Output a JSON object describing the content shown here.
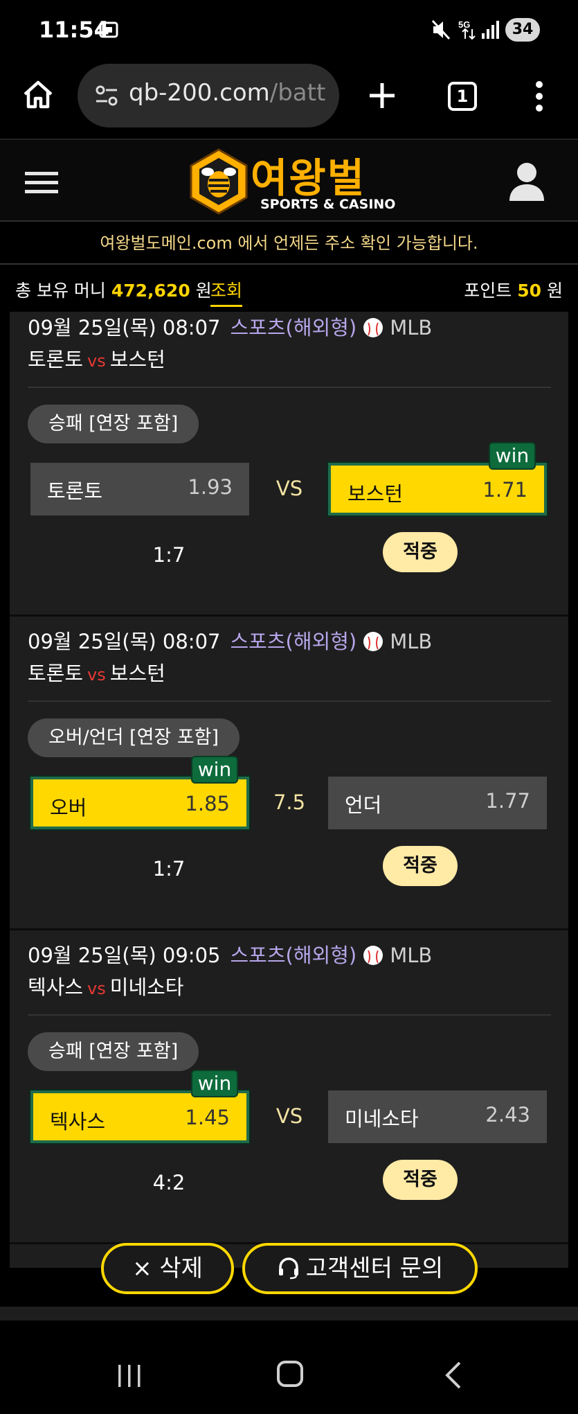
{
  "status_bar": {
    "time": "11:54",
    "battery": "34"
  },
  "browser": {
    "url_host": "qb-200.com",
    "url_path": "/batt",
    "tab_count": "1"
  },
  "site": {
    "logo_text": "여왕벌",
    "logo_sub": "SPORTS & CASINO",
    "notice": "여왕벌도메인.com 에서 언제든 주소 확인 가능합니다."
  },
  "balance": {
    "label": "총 보유 머니",
    "amount": "472,620",
    "unit": "원",
    "check": "조회",
    "points_label": "포인트",
    "points": "50",
    "points_unit": "원"
  },
  "bets": [
    {
      "datetime": "09월 25일(목) 08:07",
      "type": "스포츠(해외형)",
      "league": "MLB",
      "home": "토론토",
      "away": "보스턴",
      "vs": "vs",
      "market": "승패 [연장 포함]",
      "left": {
        "label": "토론토",
        "odds": "1.93",
        "win": false
      },
      "middle": "VS",
      "right": {
        "label": "보스턴",
        "odds": "1.71",
        "win": true
      },
      "win_tag": "win",
      "score": "1:7",
      "result": "적중"
    },
    {
      "datetime": "09월 25일(목) 08:07",
      "type": "스포츠(해외형)",
      "league": "MLB",
      "home": "토론토",
      "away": "보스턴",
      "vs": "vs",
      "market": "오버/언더 [연장 포함]",
      "left": {
        "label": "오버",
        "odds": "1.85",
        "win": true
      },
      "middle": "7.5",
      "right": {
        "label": "언더",
        "odds": "1.77",
        "win": false
      },
      "win_tag": "win",
      "score": "1:7",
      "result": "적중"
    },
    {
      "datetime": "09월 25일(목) 09:05",
      "type": "스포츠(해외형)",
      "league": "MLB",
      "home": "텍사스",
      "away": "미네소타",
      "vs": "vs",
      "market": "승패 [연장 포함]",
      "left": {
        "label": "텍사스",
        "odds": "1.45",
        "win": true
      },
      "middle": "VS",
      "right": {
        "label": "미네소타",
        "odds": "2.43",
        "win": false
      },
      "win_tag": "win",
      "score": "4:2",
      "result": "적중"
    }
  ],
  "actions": {
    "delete": "× 삭제",
    "support": "고객센터 문의"
  },
  "colors": {
    "accent": "#ffd800",
    "win_green": "#0d6b3c",
    "panel": "#1e1e1e",
    "type_purple": "#b7a6ea"
  },
  "icons": [
    "home-icon",
    "tune-icon",
    "plus-icon",
    "tabs-icon",
    "more-vert-icon",
    "menu-icon",
    "bee-logo-icon",
    "user-icon",
    "baseball-icon",
    "headset-icon",
    "nav-recents-icon",
    "nav-home-icon",
    "nav-back-icon"
  ]
}
